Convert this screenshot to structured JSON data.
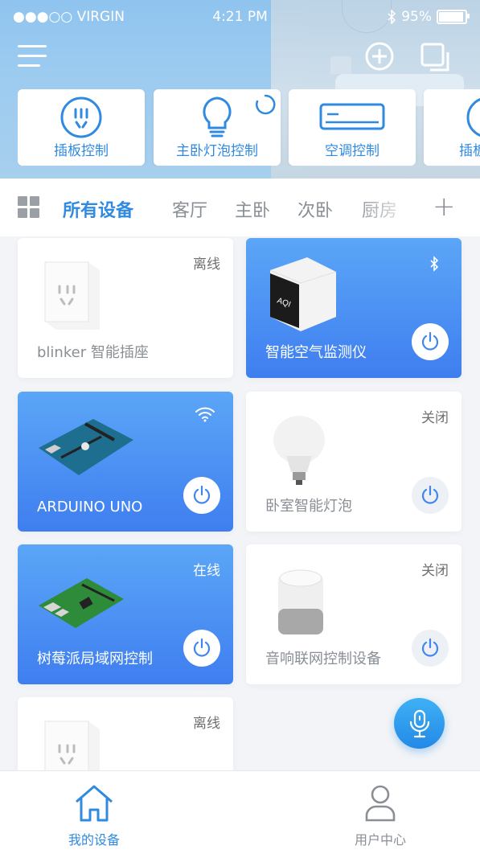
{
  "status_bar": {
    "carrier": "●●●○○ VIRGIN",
    "time": "4:21 PM",
    "battery": "95%",
    "battery_level": 0.95
  },
  "scenes": [
    {
      "label": "插板控制",
      "icon": "socket-icon"
    },
    {
      "label": "主卧灯泡控制",
      "icon": "bulb-icon"
    },
    {
      "label": "空调控制",
      "icon": "air-conditioner-icon"
    },
    {
      "label": "插板",
      "icon": "socket-icon"
    }
  ],
  "tabs": [
    "所有设备",
    "客厅",
    "主卧",
    "次卧",
    "厨房"
  ],
  "active_tab": "所有设备",
  "devices": [
    {
      "name": "blinker 智能插座",
      "state": "离线",
      "active": false
    },
    {
      "name": "智能空气监测仪",
      "state": "",
      "active": true,
      "indicator": "bluetooth-icon"
    },
    {
      "name": "ARDUINO UNO",
      "state": "",
      "active": true,
      "indicator": "wifi-icon"
    },
    {
      "name": "卧室智能灯泡",
      "state": "关闭",
      "active": false
    },
    {
      "name": "树莓派局域网控制",
      "state": "在线",
      "active": true
    },
    {
      "name": "音响联网控制设备",
      "state": "关闭",
      "active": false
    },
    {
      "name": "",
      "state": "离线",
      "active": false
    }
  ],
  "air_monitor_screen": "AQI",
  "bottom_nav": {
    "home": "我的设备",
    "user": "用户中心"
  },
  "colors": {
    "accent": "#2f8ae0",
    "card_blue_top": "#5ba6f7",
    "card_blue_bottom": "#3f7ef0"
  }
}
